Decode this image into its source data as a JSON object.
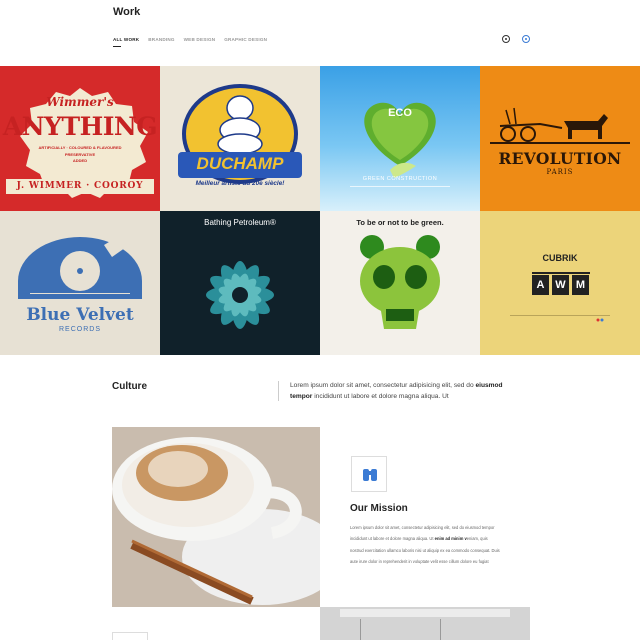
{
  "header": {
    "title": "Work",
    "filters": [
      "ALL WORK",
      "BRANDING",
      "WEB DESIGN",
      "GRAPHIC DESIGN"
    ]
  },
  "portfolio": {
    "tiles": [
      {
        "lines": [
          "Wimmer's",
          "ANYTHING",
          "ARTIFICIALLY · COLOURED & FLAVOURED",
          "PRESERVATIVE",
          "ADDED",
          "J. WIMMER · COOROY"
        ]
      },
      {
        "lines": [
          "DUCHAMP",
          "Meilleur artiste du 20e siècle!"
        ]
      },
      {
        "lines": [
          "ECO",
          "GREEN CONSTRUCTION"
        ]
      },
      {
        "lines": [
          "REVOLUTION",
          "PARIS"
        ]
      },
      {
        "lines": [
          "Blue Velvet",
          "RECORDS"
        ]
      },
      {
        "lines": [
          "Bathing Petroleum®"
        ]
      },
      {
        "lines": [
          "To be or not to be green."
        ]
      },
      {
        "lines": [
          "CUBRIK",
          "A",
          "W",
          "M"
        ]
      }
    ]
  },
  "culture": {
    "title": "Culture",
    "text_a": "Lorem ipsum dolor sit amet, consectetur adipisicing elit, sed do",
    "text_bold": "eiusmod tempor",
    "text_b": "incididunt ut labore et dolore magna aliqua. Ut"
  },
  "mission": {
    "title": "Our Mission",
    "line1": "Lorem ipsum dolor sit amet, consectetur adipisicing elit, sed do eiusmod tempor",
    "line2a": "incididunt ut labore et dolore magna aliqua. Ut",
    "line2bold": "enim ad minim v",
    "line2b": "eniam, quis",
    "line3": "nostrud exercitation ullamco laboris nisi ut aliquip ex ea commodo consequat. Duis",
    "line4": "aute irure dolor in reprehenderit in voluptate velit esse cillum dolore eu fugiat"
  },
  "colors": {
    "accent": "#3b7bd4",
    "red_tile": "#d52a2a",
    "orange_tile": "#ee8b15",
    "dark_tile": "#10212a",
    "yellow_tile": "#ecd47a"
  },
  "icons": [
    "settings-icon",
    "globe-icon",
    "binoculars-icon"
  ]
}
